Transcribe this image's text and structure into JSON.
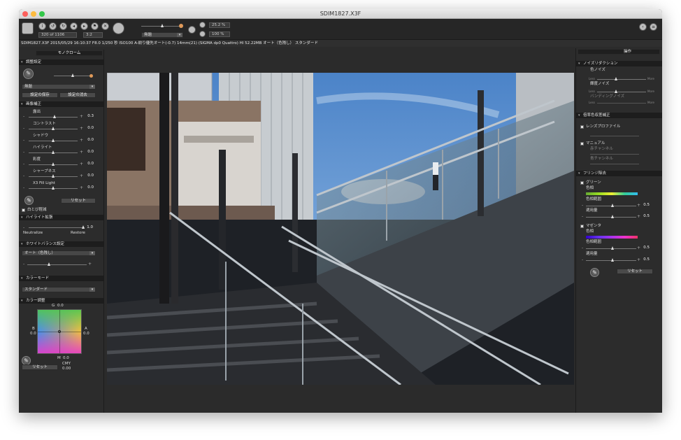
{
  "window": {
    "title": "SDIM1827.X3F"
  },
  "toolbar": {
    "zoom_value": "320 of 1106",
    "ratio_value": "3:2",
    "preset_value": "無題",
    "zoom_percent": "25.2 %",
    "scale_percent": "100 %"
  },
  "info_bar": {
    "text": "SDIM1827.X3F 2015/05/29 16:10:37 F8.0 1/250 秒 ISO100 A-絞り優先オート(-0.7) 14mm(21) (SIGMA dp0 Quattro) HI 52.22MB オート（色残し） スタンダード"
  },
  "left_panel": {
    "tab_label": "モノクローム",
    "adjust": {
      "header": "調整設定",
      "preset_value": "無題",
      "save_label": "設定の保存",
      "delete_label": "設定の消去"
    },
    "image_correction": {
      "header": "画像補正",
      "sliders": [
        {
          "label": "露出",
          "value": "0.3",
          "pos": 0.53
        },
        {
          "label": "コントラスト",
          "value": "0.0",
          "pos": 0.5
        },
        {
          "label": "シャドウ",
          "value": "0.0",
          "pos": 0.5
        },
        {
          "label": "ハイライト",
          "value": "0.0",
          "pos": 0.5
        },
        {
          "label": "彩度",
          "value": "0.0",
          "pos": 0.5
        },
        {
          "label": "シャープネス",
          "value": "0.0",
          "pos": 0.5
        },
        {
          "label": "X3 Fill Light",
          "value": "0.0",
          "pos": 0.5
        }
      ],
      "reset_label": "リセット",
      "white_black_label": "白とび軽減"
    },
    "highlight": {
      "header": "ハイライト拡張",
      "value": "1.0",
      "left_label": "Neutralize",
      "right_label": "Restore"
    },
    "white_balance": {
      "header": "ホワイトバランス設定",
      "value": "オート（色残し）"
    },
    "color_mode": {
      "header": "カラーモード",
      "value": "スタンダード"
    },
    "color_adjust": {
      "header": "カラー調整",
      "g_label": "G",
      "g_value": "0.0",
      "b_label": "B",
      "b_value": "0.0",
      "a_label": "A",
      "a_value": "0.0",
      "m_label": "M",
      "m_value": "0.0",
      "cmy_label": "CMY",
      "cmy_value": "0.00",
      "reset_label": "リセット"
    }
  },
  "right_panel": {
    "tab_label": "操作",
    "noise": {
      "header": "ノイズリダクション",
      "color_label": "色ノイズ",
      "luma_label": "輝度ノイズ",
      "banding_label": "バンディングノイズ",
      "less_label": "Less",
      "more_label": "More"
    },
    "lens": {
      "header": "倍率色収差補正",
      "profile_label": "レンズプロファイル",
      "manual_label": "マニュアル",
      "red_label": "赤チャンネル",
      "blue_label": "青チャンネル"
    },
    "fringe": {
      "header": "フリンジ除去",
      "green_label": "グリーン",
      "hue_label": "色相",
      "hue_range_label": "色相範囲",
      "amount_label": "適用量",
      "green_range_value": "0.5",
      "green_amount_value": "0.5",
      "magenta_label": "マゼンタ",
      "magenta_range_value": "0.5",
      "magenta_amount_value": "0.5",
      "reset_label": "リセット"
    }
  },
  "colors": {
    "background": "#2b2b2b",
    "panel": "#2c2c2c",
    "header": "#1d1d1d",
    "accent": "#e09a5a"
  }
}
